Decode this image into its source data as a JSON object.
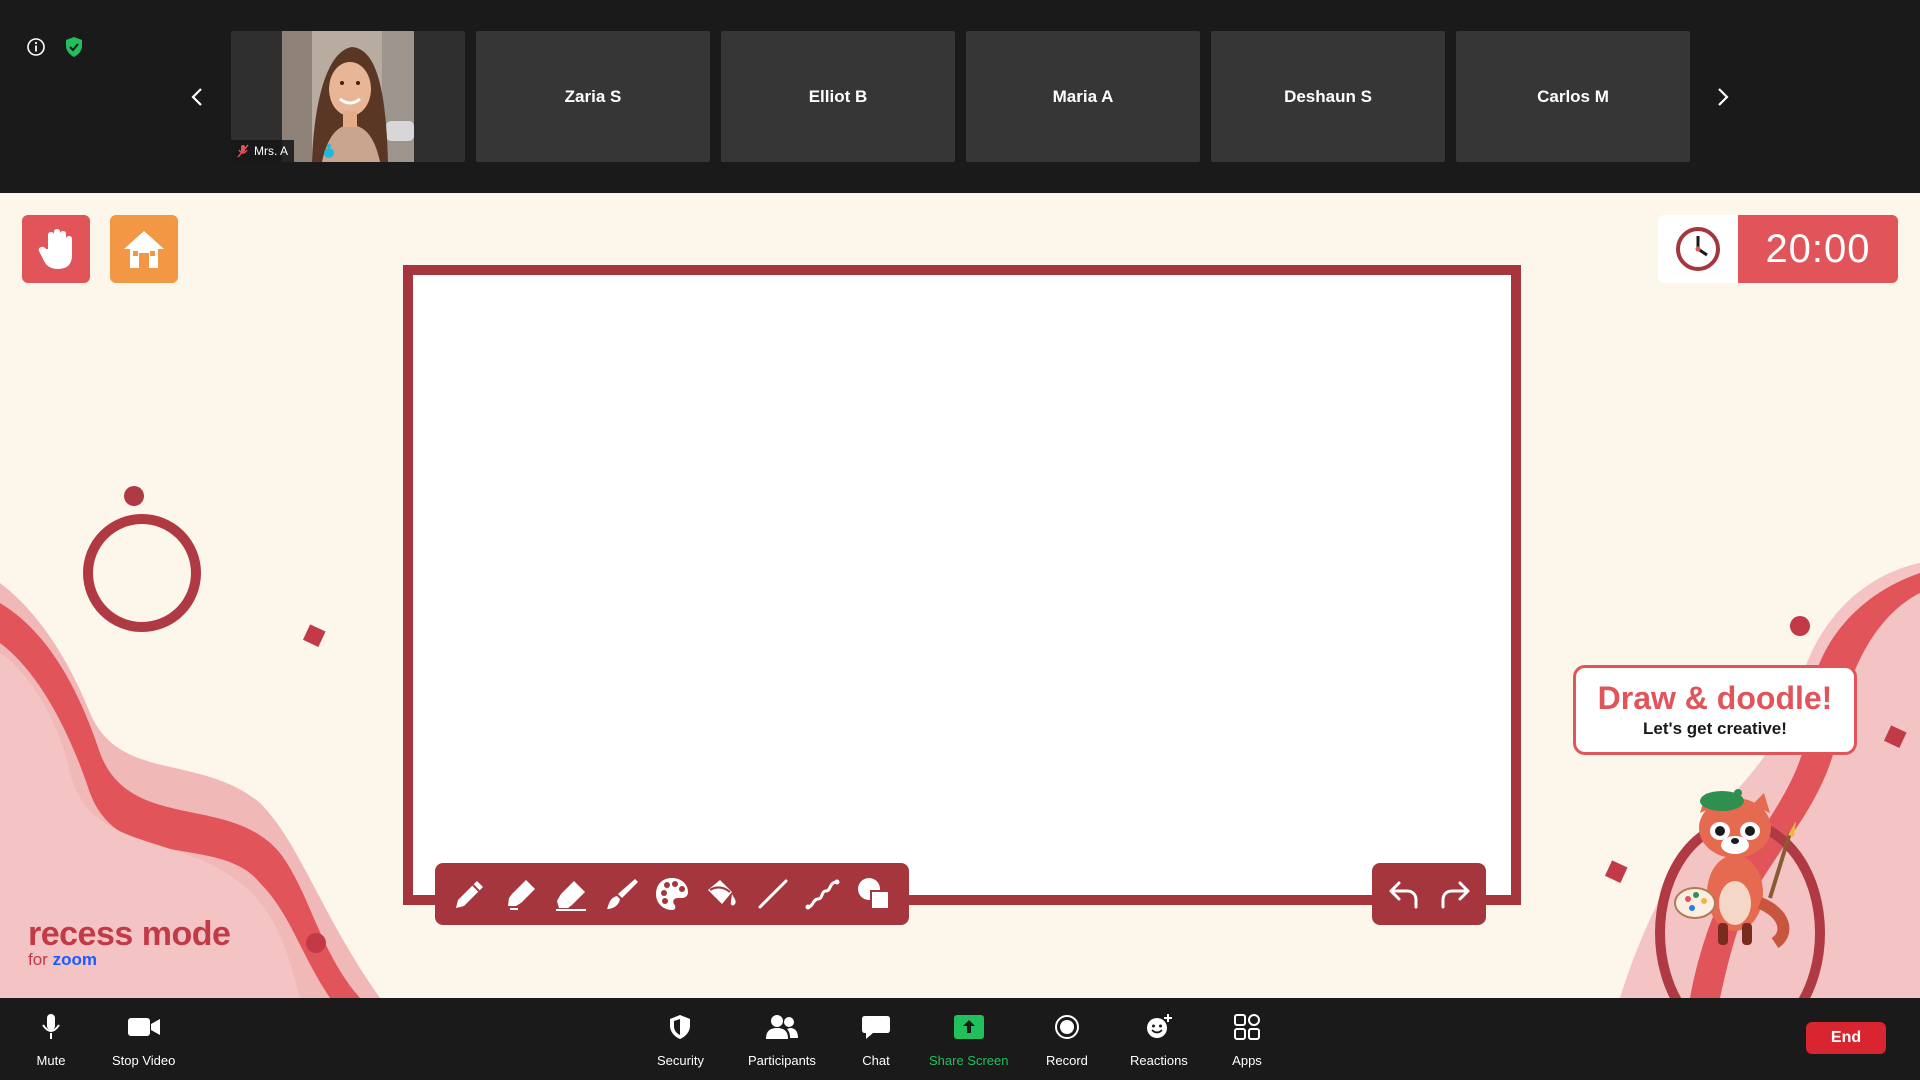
{
  "gallery": {
    "self": {
      "name": "Mrs. A"
    },
    "participants": [
      {
        "name": "Zaria S"
      },
      {
        "name": "Elliot B"
      },
      {
        "name": "Maria A"
      },
      {
        "name": "Deshaun S"
      },
      {
        "name": "Carlos M"
      }
    ]
  },
  "timer": {
    "value": "20:00"
  },
  "bubble": {
    "title": "Draw & doodle!",
    "subtitle": "Let's get creative!"
  },
  "brand": {
    "line1": "recess mode",
    "line2_prefix": "for",
    "line2_brand": "zoom"
  },
  "draw_tools": [
    "pencil-icon",
    "marker-icon",
    "eraser-icon",
    "brush-icon",
    "palette-icon",
    "fill-bucket-icon",
    "line-icon",
    "squiggle-icon",
    "shapes-icon"
  ],
  "toolbar": {
    "mute": "Mute",
    "stop_video": "Stop Video",
    "security": "Security",
    "participants": "Participants",
    "chat": "Chat",
    "share_screen": "Share Screen",
    "record": "Record",
    "reactions": "Reactions",
    "apps": "Apps",
    "end": "End"
  },
  "colors": {
    "accent_red": "#e0545a",
    "board_red": "#a5363d",
    "orange": "#f29744",
    "stage_bg": "#fdf6ea",
    "share_green": "#20c05c",
    "end_red": "#d9252f"
  }
}
